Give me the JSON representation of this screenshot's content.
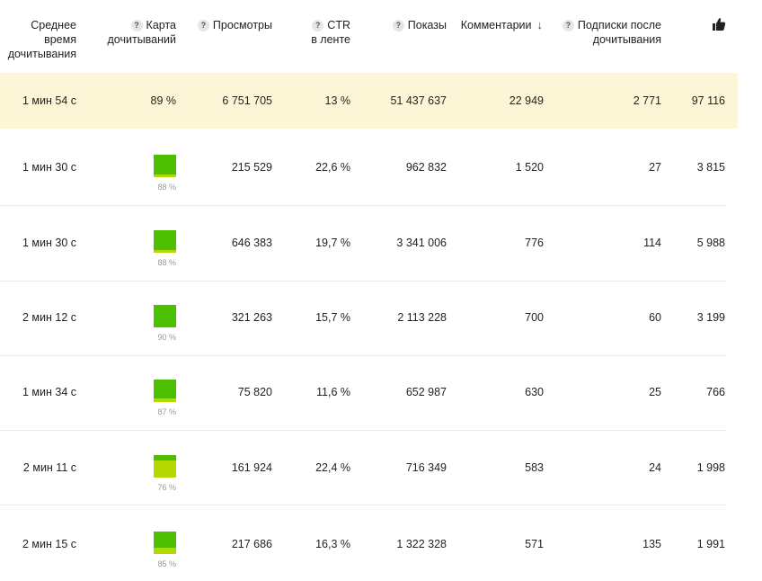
{
  "columns": {
    "avg_time": [
      "Среднее время",
      "дочитывания"
    ],
    "read_map": [
      "Карта",
      "дочитываний"
    ],
    "views": "Просмотры",
    "ctr": [
      "CTR",
      "в ленте"
    ],
    "impressions": "Показы",
    "comments": "Комментарии",
    "subs": [
      "Подписки после",
      "дочитывания"
    ],
    "help_glyph": "?",
    "sort_icon": "arrow-down-icon",
    "likes_icon": "thumbs-up-icon"
  },
  "summary": {
    "avg_time": "1 мин 54 с",
    "read_map": "89 %",
    "views": "6 751 705",
    "ctr": "13 %",
    "impressions": "51 437 637",
    "comments": "22 949",
    "subs": "2 771",
    "likes": "97 116"
  },
  "colors": {
    "summary_bg": "#fdf6d6",
    "map_green": "#4cbf00",
    "map_yellow": "#b5d800"
  },
  "rows": [
    {
      "avg_time": "1 мин 30 с",
      "read_pct": "88 %",
      "read_fraction": 0.88,
      "views": "215 529",
      "ctr": "22,6 %",
      "impressions": "962 832",
      "comments": "1 520",
      "subs": "27",
      "likes": "3 815"
    },
    {
      "avg_time": "1 мин 30 с",
      "read_pct": "88 %",
      "read_fraction": 0.88,
      "views": "646 383",
      "ctr": "19,7 %",
      "impressions": "3 341 006",
      "comments": "776",
      "subs": "114",
      "likes": "5 988"
    },
    {
      "avg_time": "2 мин 12 с",
      "read_pct": "90 %",
      "read_fraction": 0.9,
      "views": "321 263",
      "ctr": "15,7 %",
      "impressions": "2 113 228",
      "comments": "700",
      "subs": "60",
      "likes": "3 199"
    },
    {
      "avg_time": "1 мин 34 с",
      "read_pct": "87 %",
      "read_fraction": 0.87,
      "views": "75 820",
      "ctr": "11,6 %",
      "impressions": "652 987",
      "comments": "630",
      "subs": "25",
      "likes": "766"
    },
    {
      "avg_time": "2 мин 11 с",
      "read_pct": "76 %",
      "read_fraction": 0.76,
      "views": "161 924",
      "ctr": "22,4 %",
      "impressions": "716 349",
      "comments": "583",
      "subs": "24",
      "likes": "1 998"
    },
    {
      "avg_time": "2 мин 15 с",
      "read_pct": "85 %",
      "read_fraction": 0.85,
      "views": "217 686",
      "ctr": "16,3 %",
      "impressions": "1 322 328",
      "comments": "571",
      "subs": "135",
      "likes": "1 991"
    }
  ]
}
